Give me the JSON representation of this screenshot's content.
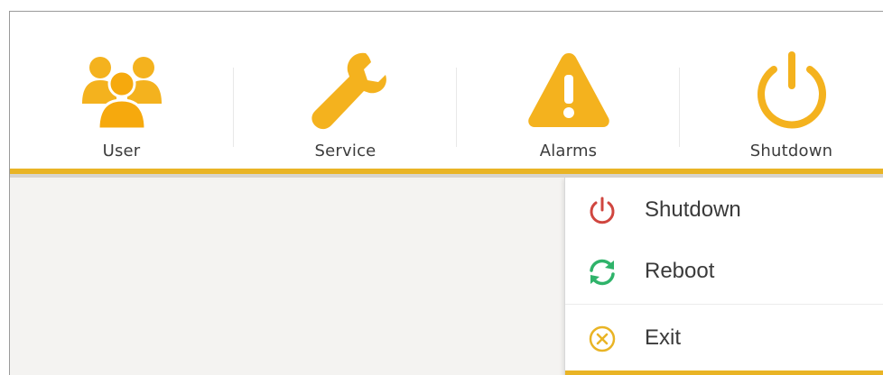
{
  "toolbar": {
    "items": [
      {
        "label": "User",
        "icon": "users-icon"
      },
      {
        "label": "Service",
        "icon": "wrench-icon"
      },
      {
        "label": "Alarms",
        "icon": "warning-icon"
      },
      {
        "label": "Shutdown",
        "icon": "power-icon"
      }
    ]
  },
  "menu": {
    "items": [
      {
        "label": "Shutdown",
        "icon": "power-icon",
        "color": "#d0463f"
      },
      {
        "label": "Reboot",
        "icon": "refresh-icon",
        "color": "#2fb36a"
      },
      {
        "label": "Exit",
        "icon": "close-circle-icon",
        "color": "#e9b425"
      }
    ]
  },
  "colors": {
    "accent": "#e9b425",
    "icon_orange": "#f4b21e",
    "content_bg": "#f4f3f1"
  }
}
